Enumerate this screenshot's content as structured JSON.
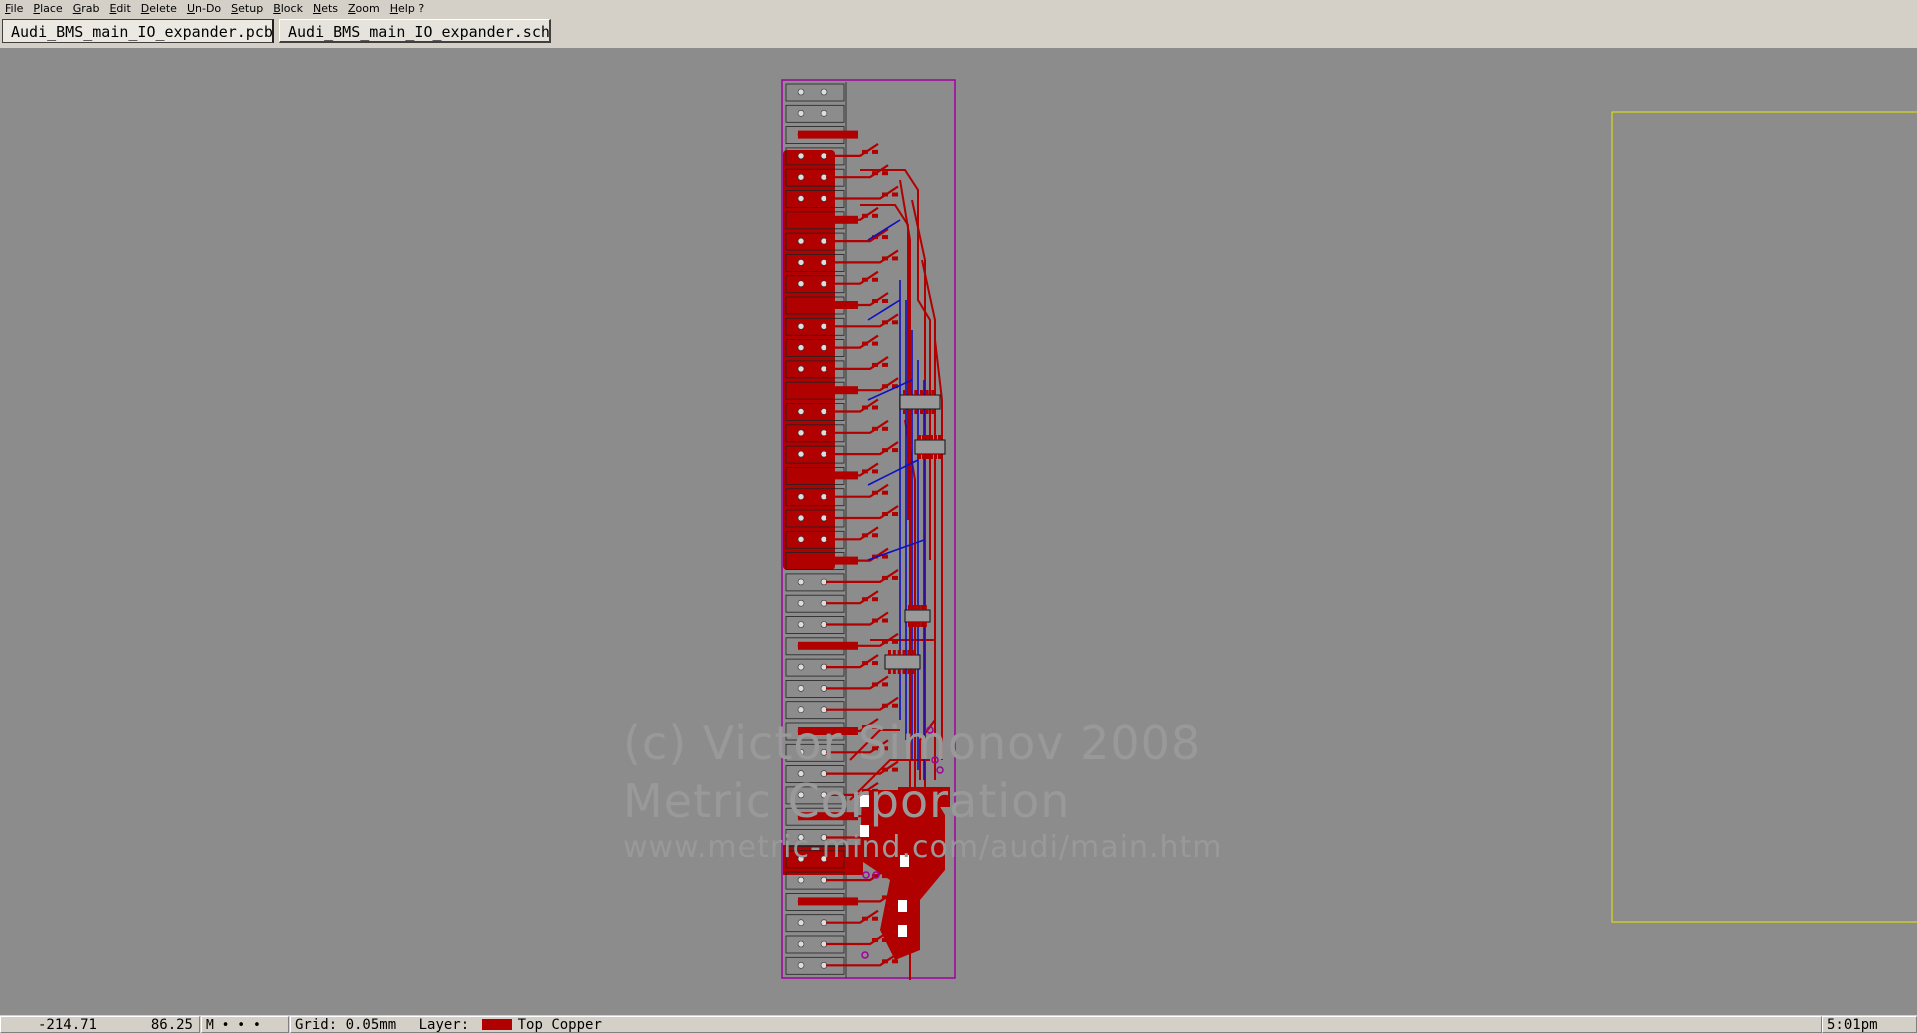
{
  "menu": [
    "File",
    "Place",
    "Grab",
    "Edit",
    "Delete",
    "Un-Do",
    "Setup",
    "Block",
    "Nets",
    "Zoom",
    "Help ?"
  ],
  "tabs": [
    {
      "label": "Audi_BMS_main_IO_expander.pcb",
      "active": true
    },
    {
      "label": "Audi_BMS_main_IO_expander.sch",
      "active": false
    }
  ],
  "watermark": {
    "line1": "(c) Victor Simonov 2008",
    "line2": "Metric Corporation",
    "line3": "www.metric-mind.com/audi/main.htm"
  },
  "status": {
    "x": "-214.71",
    "y": "86.25",
    "mode": "M • • •",
    "grid": "Grid: 0.05mm",
    "layer_label": "Layer:",
    "layer_name": "Top Copper",
    "layer_color": "#b00000",
    "clock": "5:01pm"
  },
  "colors": {
    "copper_top": "#b00000",
    "copper_bottom": "#1010c0",
    "board_outline": "#a000a0",
    "sheet_outline": "#e8e800"
  }
}
